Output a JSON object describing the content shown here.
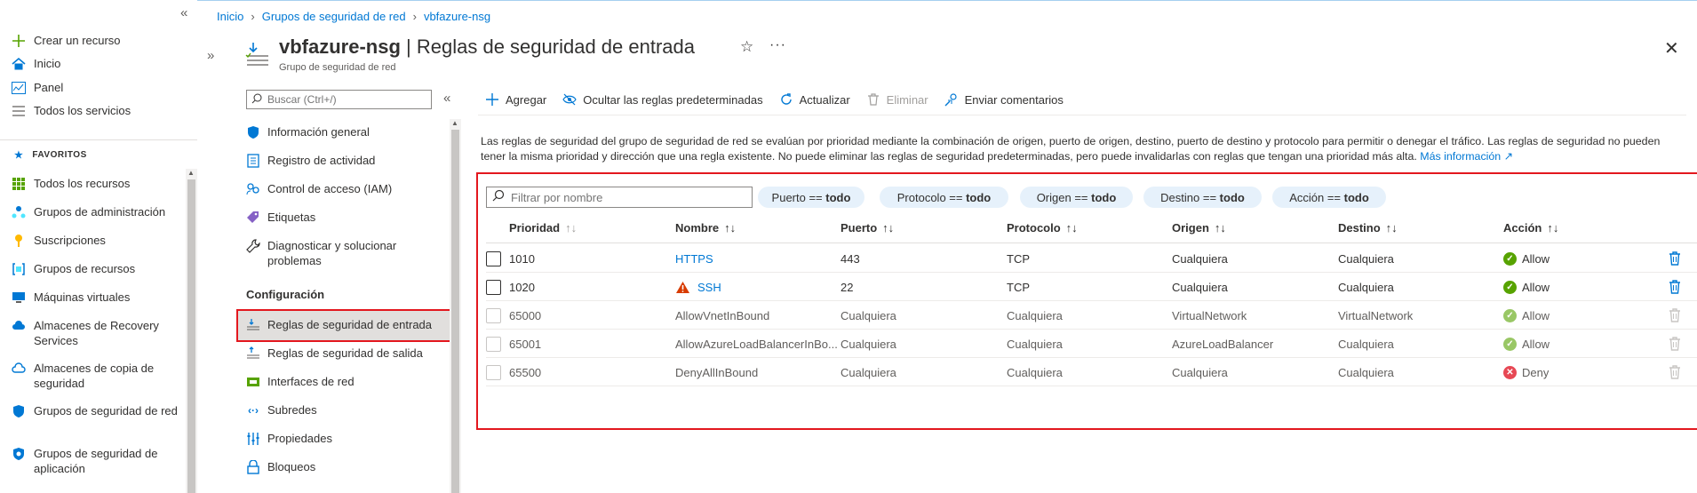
{
  "left_nav": {
    "create": "Crear un recurso",
    "home": "Inicio",
    "dashboard": "Panel",
    "all_services": "Todos los servicios",
    "favorites_label": "FAVORITOS",
    "items": [
      "Todos los recursos",
      "Grupos de administración",
      "Suscripciones",
      "Grupos de recursos",
      "Máquinas virtuales",
      "Almacenes de Recovery Services",
      "Almacenes de copia de seguridad",
      "Grupos de seguridad de red",
      "Grupos de seguridad de aplicación"
    ]
  },
  "breadcrumb": [
    "Inicio",
    "Grupos de seguridad de red",
    "vbfazure-nsg"
  ],
  "header": {
    "resource_name": "vbfazure-nsg",
    "page_title": "Reglas de seguridad de entrada",
    "subtitle": "Grupo de seguridad de red"
  },
  "menu": {
    "search_placeholder": "Buscar (Ctrl+/)",
    "items_top": [
      "Información general",
      "Registro de actividad",
      "Control de acceso (IAM)",
      "Etiquetas",
      "Diagnosticar y solucionar problemas"
    ],
    "section": "Configuración",
    "items_config": [
      "Reglas de seguridad de entrada",
      "Reglas de seguridad de salida",
      "Interfaces de red",
      "Subredes",
      "Propiedades",
      "Bloqueos"
    ]
  },
  "commands": {
    "add": "Agregar",
    "hide_defaults": "Ocultar las reglas predeterminadas",
    "refresh": "Actualizar",
    "delete": "Eliminar",
    "feedback": "Enviar comentarios"
  },
  "description": {
    "text": "Las reglas de seguridad del grupo de seguridad de red se evalúan por prioridad mediante la combinación de origen, puerto de origen, destino, puerto de destino y protocolo para permitir o denegar el tráfico. Las reglas de seguridad no pueden tener la misma prioridad y dirección que una regla existente. No puede eliminar las reglas de seguridad predeterminadas, pero puede invalidarlas con reglas que tengan una prioridad más alta.",
    "link": "Más información"
  },
  "filter": {
    "placeholder": "Filtrar por nombre",
    "pills": [
      {
        "label": "Puerto ==",
        "value": "todo"
      },
      {
        "label": "Protocolo ==",
        "value": "todo"
      },
      {
        "label": "Origen ==",
        "value": "todo"
      },
      {
        "label": "Destino ==",
        "value": "todo"
      },
      {
        "label": "Acción ==",
        "value": "todo"
      }
    ]
  },
  "table": {
    "columns": [
      "Prioridad",
      "Nombre",
      "Puerto",
      "Protocolo",
      "Origen",
      "Destino",
      "Acción"
    ],
    "rows": [
      {
        "priority": "1010",
        "name": "HTTPS",
        "port": "443",
        "protocol": "TCP",
        "source": "Cualquiera",
        "destination": "Cualquiera",
        "action": "Allow"
      },
      {
        "priority": "1020",
        "name": "SSH",
        "port": "22",
        "protocol": "TCP",
        "source": "Cualquiera",
        "destination": "Cualquiera",
        "action": "Allow"
      },
      {
        "priority": "65000",
        "name": "AllowVnetInBound",
        "port": "Cualquiera",
        "protocol": "Cualquiera",
        "source": "VirtualNetwork",
        "destination": "VirtualNetwork",
        "action": "Allow"
      },
      {
        "priority": "65001",
        "name": "AllowAzureLoadBalancerInBo...",
        "port": "Cualquiera",
        "protocol": "Cualquiera",
        "source": "AzureLoadBalancer",
        "destination": "Cualquiera",
        "action": "Allow"
      },
      {
        "priority": "65500",
        "name": "DenyAllInBound",
        "port": "Cualquiera",
        "protocol": "Cualquiera",
        "source": "Cualquiera",
        "destination": "Cualquiera",
        "action": "Deny"
      }
    ]
  },
  "colors": {
    "accent": "#0078d4",
    "highlight_border": "#e3171e",
    "allow": "#57a300",
    "deny": "#e00b1c",
    "warning": "#d83b01"
  }
}
